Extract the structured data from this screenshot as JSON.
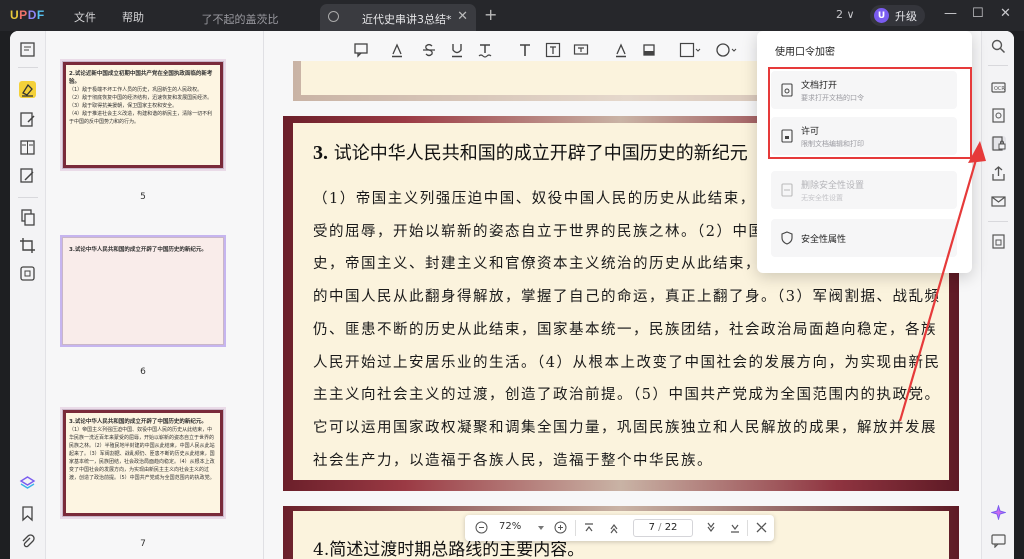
{
  "app": {
    "logo": {
      "u": "U",
      "p": "P",
      "d": "D",
      "f": "F"
    }
  },
  "menu": {
    "file": "文件",
    "help": "帮助"
  },
  "tabs": {
    "inactive_label": "了不起的盖茨比",
    "active_label": "近代史串讲3总结*",
    "close_glyph": "✕",
    "add_glyph": "+"
  },
  "window": {
    "count": "2 ∨",
    "upgrade_label": "升级",
    "upgrade_avatar": "U",
    "minimize": "—",
    "maximize": "☐",
    "close": "✕"
  },
  "thumbnails": [
    {
      "page": "5",
      "q": "2.试论近新中国成立初期中国共产党在全国执政面临的新考验。",
      "lines": [
        "（1）敌于极端不坏工作人员的历史，巩固新生的人民政权。",
        "（2）敌于彻底恢复中国的经济结构，迅速恢复和发展国民经济。",
        "（3）敌于取得抗美援朝，保卫国家主权和安全。",
        "（4）敌于推进社会主义改造，构建和谐的新民主，清除一切不利于中国的反中国势力和的行为。"
      ]
    },
    {
      "page": "6",
      "q": "3.试论中华人民共和国的成立开辟了中国历史的新纪元。",
      "lines": []
    },
    {
      "page": "7",
      "q": "3.试论中华人民共和国的成立开辟了中国历史的新纪元。",
      "lines": [
        "（1）帝国主义列强压迫中国、奴役中国人民的历史从此结束，中华民族一洗近百年来蒙受的屈辱，开始以崭新的姿态自立于世界的民族之林。（2）半殖民地半封建的中国从此结束，中国人民从此站起来了。（3）军阀割据、战乱频仍、匪患不断的历史从此结束，国家基本统一，民族团结，社会政治局面趋向稳定。（4）从根本上改变了中国社会的发展方向，为实现由新民主主义向社会主义的过渡，创造了政治前提。（5）中国共产党成为全国范围内的执政党。"
      ]
    }
  ],
  "document": {
    "page_title_num": "3.",
    "page_title": "试论中华人民共和国的成立开辟了中国历史的新纪元",
    "body": "（1）帝国主义列强压迫中国、奴役中国人民的历史从此结束，中华民族一洗近百年来蒙受的屈辱，开始以崭新的姿态自立于世界的民族之林。（2）中国半殖民地半封建社会的历史，帝国主义、封建主义和官僚资本主义统治的历史从此结束，长期以来受尽压迫和欺凌的中国人民从此翻身得解放，掌握了自己的命运，真正上翻了身。（3）军阀割据、战乱频仍、匪患不断的历史从此结束，国家基本统一，民族团结，社会政治局面趋向稳定，各族人民开始过上安居乐业的生活。（4）从根本上改变了中国社会的发展方向，为实现由新民主主义向社会主义的过渡，创造了政治前提。（5）中国共产党成为全国范围内的执政党。它可以运用国家政权凝聚和调集全国力量，巩固民族独立和人民解放的成果，解放并发展社会生产力，以造福于各族人民，造福于整个中华民族。",
    "next_title": "4.简述过渡时期总路线的主要内容。"
  },
  "dropdown": {
    "title": "使用口令加密",
    "items": [
      {
        "title": "文档打开",
        "subtitle": "要求打开文档的口令",
        "icon": "document-icon"
      },
      {
        "title": "许可",
        "subtitle": "限制文档编辑和打印",
        "icon": "document-lock-icon"
      },
      {
        "title": "删除安全性设置",
        "subtitle": "无安全性设置",
        "icon": "document-remove-icon",
        "disabled": true
      },
      {
        "title": "安全性属性",
        "icon": "shield-icon"
      }
    ]
  },
  "bottom_nav": {
    "zoom": "72%",
    "current_page": "7",
    "separator": "/",
    "total_pages": "22"
  },
  "colors": {
    "accent": "#7a5cf0",
    "highlight": "#e63a3a",
    "active_tool": "#f4d13a"
  }
}
